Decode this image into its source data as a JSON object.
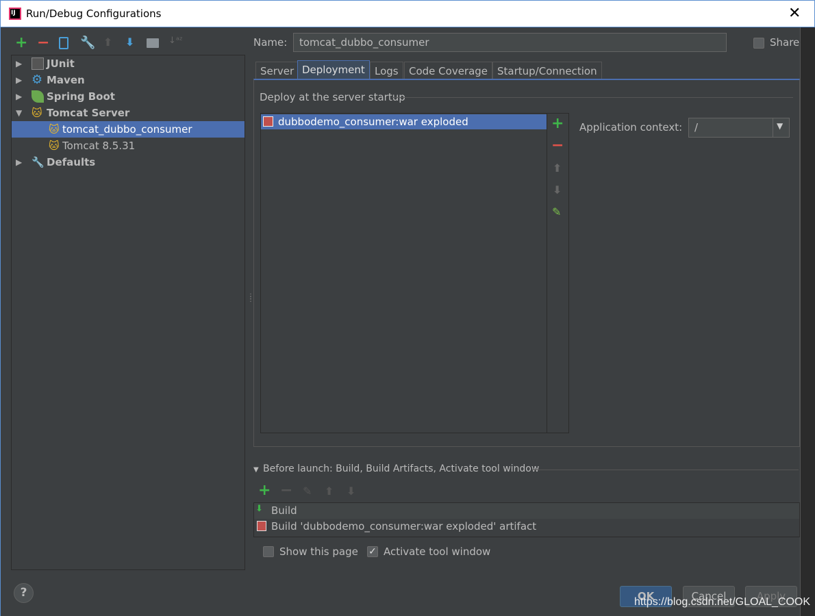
{
  "window": {
    "title": "Run/Debug Configurations",
    "close": "✕"
  },
  "toolbar": {
    "icons": [
      "add-icon",
      "remove-icon",
      "copy-icon",
      "edit-defaults-icon",
      "move-up-icon",
      "move-down-icon",
      "folder-icon",
      "sort-icon"
    ]
  },
  "tree": [
    {
      "label": "JUnit",
      "expanded": false,
      "icon": "junit-icon"
    },
    {
      "label": "Maven",
      "expanded": false,
      "icon": "maven-icon"
    },
    {
      "label": "Spring Boot",
      "expanded": false,
      "icon": "spring-boot-icon"
    },
    {
      "label": "Tomcat Server",
      "expanded": true,
      "icon": "tomcat-icon"
    },
    {
      "label": "tomcat_dubbo_consumer",
      "selected": true,
      "icon": "tomcat-icon"
    },
    {
      "label": "Tomcat 8.5.31",
      "icon": "tomcat-icon"
    },
    {
      "label": "Defaults",
      "expanded": false,
      "icon": "wrench-icon"
    }
  ],
  "name": {
    "label": "Name:",
    "value": "tomcat_dubbo_consumer"
  },
  "share": {
    "label": "Share",
    "checked": false
  },
  "tabs": [
    {
      "label": "Server"
    },
    {
      "label": "Deployment",
      "active": true
    },
    {
      "label": "Logs"
    },
    {
      "label": "Code Coverage"
    },
    {
      "label": "Startup/Connection"
    }
  ],
  "deployment": {
    "section_title": "Deploy at the server startup",
    "items": [
      "dubbodemo_consumer:war exploded"
    ],
    "app_context_label": "Application context:",
    "app_context_value": "/"
  },
  "before_launch": {
    "title": "Before launch: Build, Build Artifacts, Activate tool window",
    "items": [
      "Build",
      "Build 'dubbodemo_consumer:war exploded' artifact"
    ],
    "show_page": {
      "label": "Show this page",
      "checked": false
    },
    "activate_tool": {
      "label": "Activate tool window",
      "checked": true
    }
  },
  "buttons": {
    "help": "?",
    "ok": "OK",
    "cancel": "Cancel",
    "apply": "Apply"
  },
  "watermark": "https://blog.csdn.net/GLOAL_COOK",
  "colors": {
    "accent": "#4b6eaf",
    "background": "#3c3f41",
    "add": "#3fb54a",
    "remove": "#e0534a"
  }
}
